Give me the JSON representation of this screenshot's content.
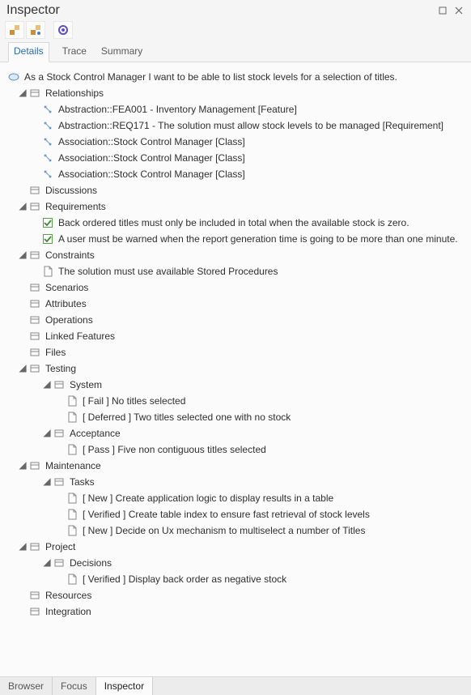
{
  "window": {
    "title": "Inspector"
  },
  "top_tabs": {
    "details": "Details",
    "trace": "Trace",
    "summary": "Summary"
  },
  "root": {
    "text": "As a Stock Control Manager I want to be able to list stock levels for a selection of titles."
  },
  "relationships": {
    "label": "Relationships",
    "items": [
      "Abstraction::FEA001 - Inventory Management [Feature]",
      "Abstraction::REQ171 - The solution must allow stock levels to be managed [Requirement]",
      "Association::Stock Control Manager [Class]",
      "Association::Stock Control Manager [Class]",
      "Association::Stock Control Manager [Class]"
    ]
  },
  "discussions": {
    "label": "Discussions"
  },
  "requirements": {
    "label": "Requirements",
    "items": [
      "Back ordered titles must only be included in total when the available stock is zero.",
      "A user must be warned when the report generation time is going to be more than one minute."
    ]
  },
  "constraints": {
    "label": "Constraints",
    "items": [
      "The solution must use available Stored Procedures"
    ]
  },
  "scenarios": {
    "label": "Scenarios"
  },
  "attributes": {
    "label": "Attributes"
  },
  "operations": {
    "label": "Operations"
  },
  "linked_features": {
    "label": "Linked Features"
  },
  "files": {
    "label": "Files"
  },
  "testing": {
    "label": "Testing",
    "system": {
      "label": "System",
      "items": [
        "[ Fail ] No titles selected",
        "[ Deferred ] Two titles selected one with no stock"
      ]
    },
    "acceptance": {
      "label": "Acceptance",
      "items": [
        "[ Pass ] Five non contiguous titles selected"
      ]
    }
  },
  "maintenance": {
    "label": "Maintenance",
    "tasks": {
      "label": "Tasks",
      "items": [
        "[ New ] Create application logic to display results in a table",
        "[ Verified ] Create table index to ensure fast retrieval of stock levels",
        "[ New ] Decide on Ux mechanism to multiselect a number of Titles"
      ]
    }
  },
  "project": {
    "label": "Project",
    "decisions": {
      "label": "Decisions",
      "items": [
        "[ Verified ] Display back order as negative stock"
      ]
    }
  },
  "resources": {
    "label": "Resources"
  },
  "integration": {
    "label": "Integration"
  },
  "bottom_tabs": {
    "browser": "Browser",
    "focus": "Focus",
    "inspector": "Inspector"
  }
}
